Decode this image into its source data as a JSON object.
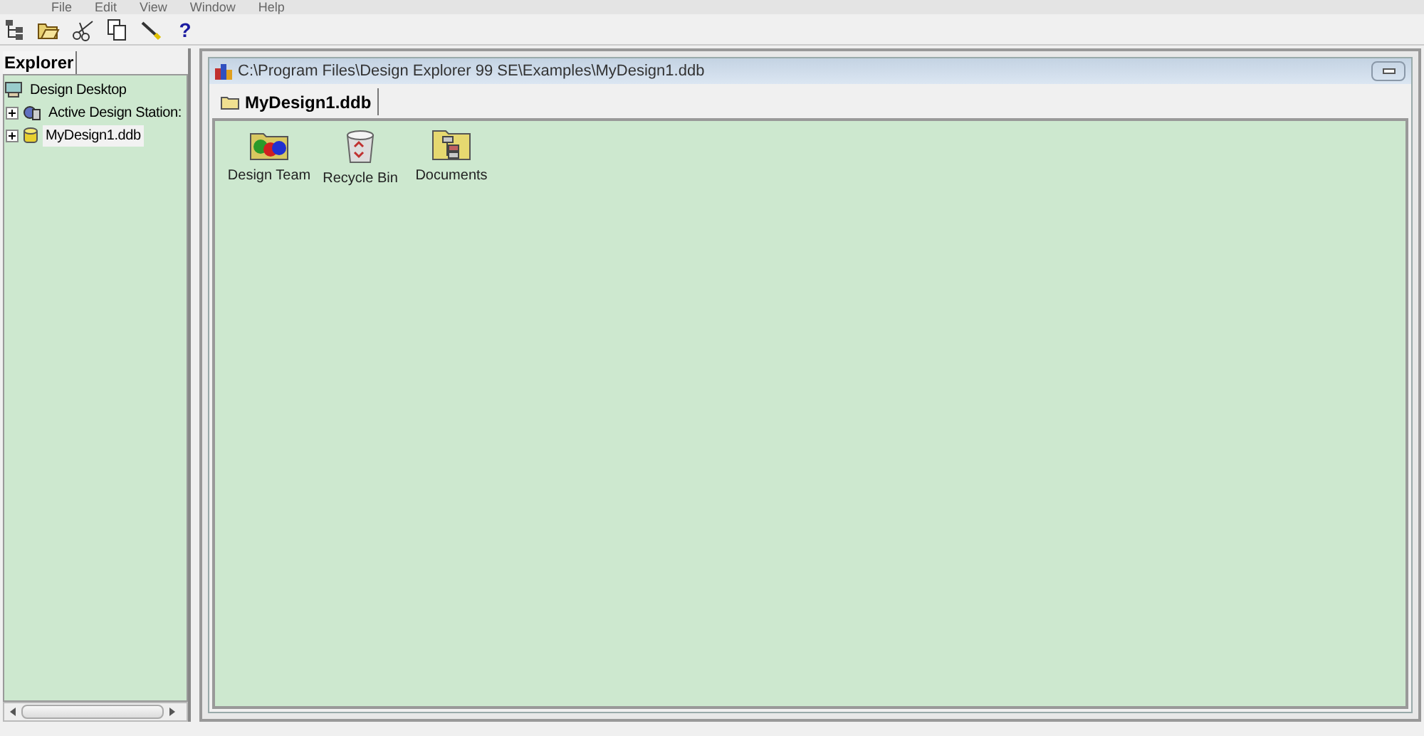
{
  "menu": [
    "File",
    "Edit",
    "View",
    "Window",
    "Help"
  ],
  "toolbar": [
    {
      "kind": "tree"
    },
    {
      "kind": "open"
    },
    {
      "kind": "cut"
    },
    {
      "kind": "copy"
    },
    {
      "kind": "wand"
    },
    {
      "kind": "help",
      "label": "?"
    }
  ],
  "explorer": {
    "tab": "Explorer",
    "tree": [
      {
        "label": "Design Desktop",
        "kind": "desktop",
        "selected": false,
        "children": [
          {
            "label": "Active Design Station:",
            "kind": "station",
            "expanded": false,
            "selected": false
          },
          {
            "label": "MyDesign1.ddb",
            "kind": "database",
            "expanded": false,
            "selected": true
          }
        ]
      }
    ]
  },
  "document": {
    "title": "C:\\Program Files\\Design Explorer 99 SE\\Examples\\MyDesign1.ddb",
    "tab": "MyDesign1.ddb",
    "items": [
      {
        "label": "Design Team",
        "kind": "team"
      },
      {
        "label": "Recycle Bin",
        "kind": "bin"
      },
      {
        "label": "Documents",
        "kind": "folder"
      }
    ]
  }
}
